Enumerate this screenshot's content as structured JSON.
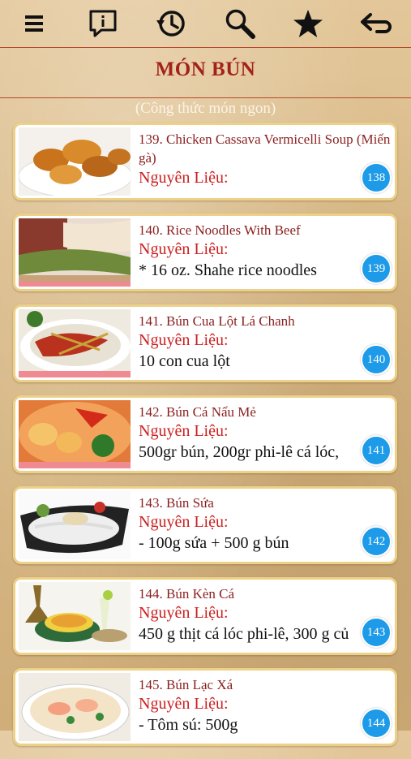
{
  "toolbar": {
    "icons": [
      "menu-icon",
      "info-icon",
      "history-icon",
      "search-icon",
      "star-icon",
      "back-icon"
    ]
  },
  "header": {
    "title": "MÓN BÚN",
    "subtitle": "(Công thức món ngon)"
  },
  "colors": {
    "title": "#a3231a",
    "badge": "#1e9be8",
    "card_border": "#edd189",
    "ingredient_label": "#cc1f1f"
  },
  "recipes": [
    {
      "title": "139. Chicken Cassava Vermicelli Soup (Miến gà)",
      "label": "Nguyên Liệu:",
      "line": "",
      "badge": "138"
    },
    {
      "title": "140. Rice Noodles With Beef",
      "label": "Nguyên Liệu:",
      "line": "* 16 oz. Shahe rice noodles",
      "badge": "139"
    },
    {
      "title": "141. Bún Cua Lột Lá Chanh",
      "label": "Nguyên Liệu:",
      "line": "10 con cua lột",
      "badge": "140"
    },
    {
      "title": "142. Bún Cá Nấu Mẻ",
      "label": "Nguyên Liệu:",
      "line": "500gr bún, 200gr phi-lê cá lóc,",
      "badge": "141"
    },
    {
      "title": "143. Bún Sứa",
      "label": "Nguyên Liệu:",
      "line": "- 100g sứa + 500 g bún",
      "badge": "142"
    },
    {
      "title": "144. Bún Kèn Cá",
      "label": "Nguyên Liệu:",
      "line": "450 g thịt cá lóc phi-lê, 300 g củ",
      "badge": "143"
    },
    {
      "title": "145. Bún Lạc Xá",
      "label": "Nguyên Liệu:",
      "line": "- Tôm sú: 500g",
      "badge": "144"
    }
  ]
}
